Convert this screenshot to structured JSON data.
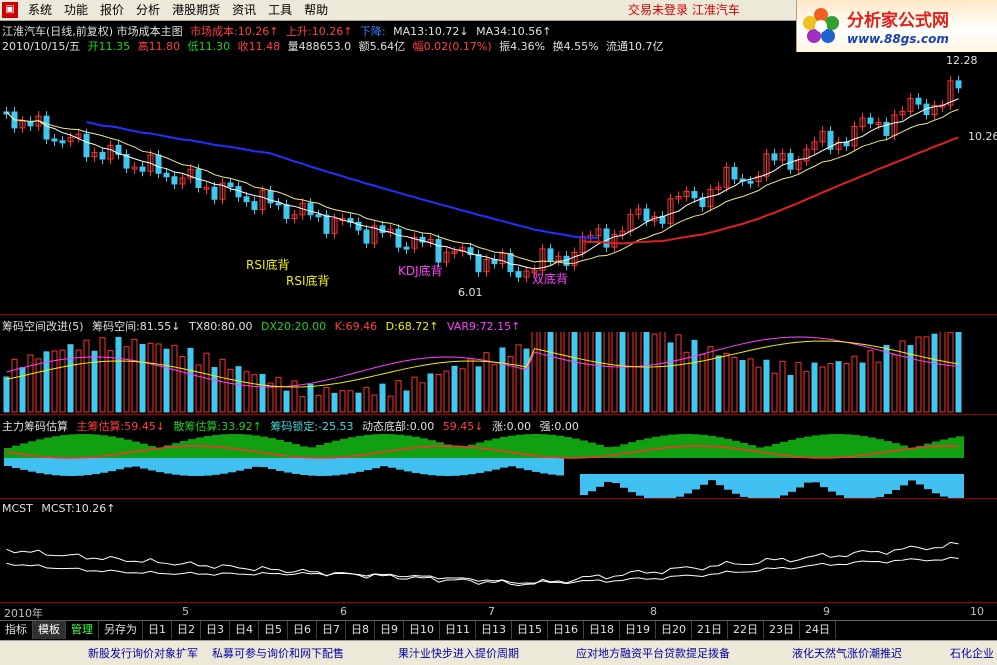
{
  "menu": {
    "items": [
      "系统",
      "功能",
      "报价",
      "分析",
      "港股期货",
      "资讯",
      "工具",
      "帮助"
    ],
    "status": "交易未登录  江淮汽车"
  },
  "logo": {
    "brand": "分析家公式网",
    "site": "www.88gs.com"
  },
  "main": {
    "line1": {
      "title": "江淮汽车(日线,前复权) 市场成本主图",
      "cost": "市场成本:10.26↑",
      "up": "上升:10.26↑",
      "down": "下降:",
      "ma13": "MA13:10.72↓",
      "ma34": "MA34:10.56↑"
    },
    "line2": {
      "date": "2010/10/15/五",
      "open": "开11.35",
      "high": "高11.80",
      "low": "低11.30",
      "close": "收11.48",
      "vol": "量488653.0",
      "amount": "额5.64亿",
      "change": "幅0.02(0.17%)",
      "amp": "振4.36%",
      "turnover": "换4.55%",
      "float": "流通10.7亿"
    },
    "price_high": "12.28",
    "price_right": "10.26",
    "annotations": {
      "rsi1": "RSI底背",
      "rsi2": "RSI底背",
      "kdj": "KDJ底背",
      "dual": "双底背",
      "low": "6.01"
    }
  },
  "pane2": {
    "title": "筹码空间改进(5)",
    "space": "筹码空间:81.55↓",
    "tx": "TX80:80.00",
    "dx": "DX20:20.00",
    "k": "K:69.46",
    "d": "D:68.72↑",
    "var": "VAR9:72.15↑"
  },
  "pane3": {
    "title": "主力筹码估算",
    "main": "主筹估算:59.45↓",
    "loose": "散筹估算:33.92↑",
    "lock": "筹码锁定:-25.53",
    "dyn": "动态底部:0.00",
    "val": "59.45↓",
    "rise": "涨:0.00",
    "strong": "强:0.00"
  },
  "pane4": {
    "title": "MCST",
    "value": "MCST:10.26↑"
  },
  "timeaxis": [
    "2010年",
    "5",
    "6",
    "7",
    "8",
    "9",
    "10"
  ],
  "tabs": [
    "指标",
    "模板",
    "管理",
    "另存为",
    "日1",
    "日2",
    "日3",
    "日4",
    "日5",
    "日6",
    "日7",
    "日8",
    "日9",
    "日10",
    "日11",
    "日13",
    "日15",
    "日16",
    "日18",
    "日19",
    "日20",
    "21日",
    "22日",
    "23日",
    "24日"
  ],
  "ticker": [
    "新股发行询价对象扩军",
    "私募可参与询价和网下配售",
    "果汁业快步进入提价周期",
    "应对地方融资平台贷款提足拨备",
    "液化天然气涨价潮推迟",
    "石化企业"
  ],
  "colors": {
    "up": "#ff3030",
    "down": "#40c8f0",
    "ma_blue": "#2030ff",
    "ma_red": "#e02020",
    "ma_yellow": "#f0e890",
    "ma_white": "#ffffff"
  }
}
